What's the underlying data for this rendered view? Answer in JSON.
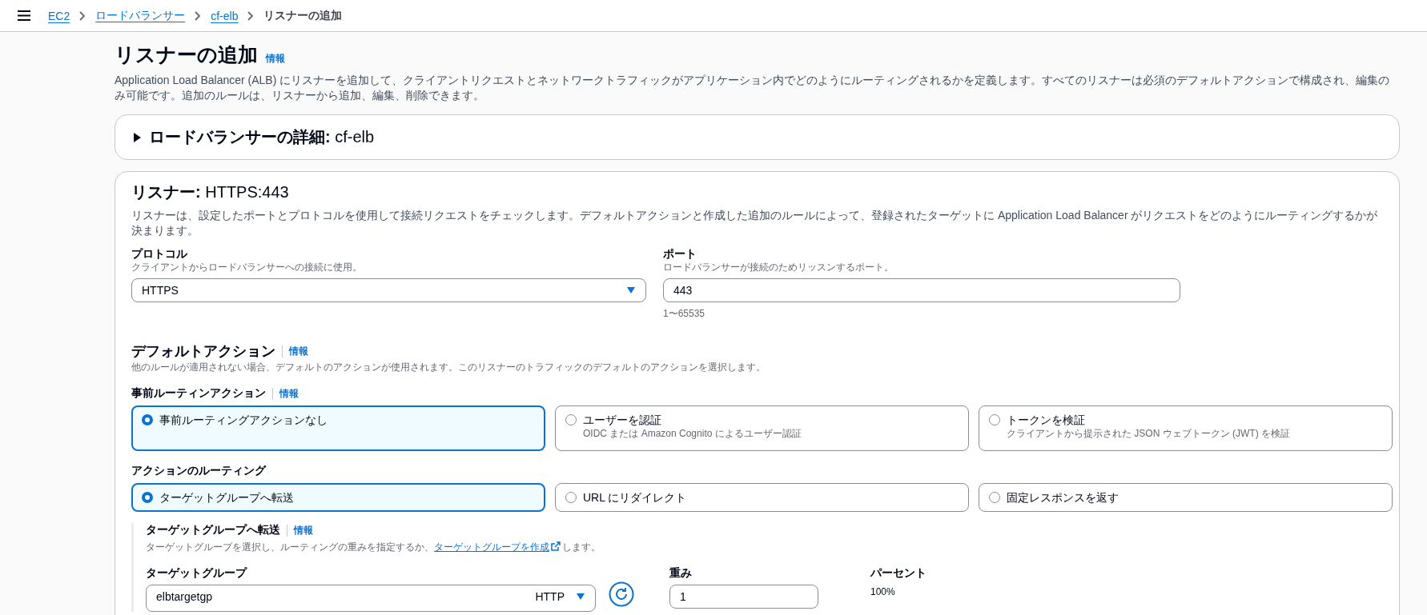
{
  "breadcrumbs": [
    {
      "label": "EC2",
      "kind": "link"
    },
    {
      "label": "ロードバランサー",
      "kind": "link"
    },
    {
      "label": "cf-elb",
      "kind": "link"
    },
    {
      "label": "リスナーの追加",
      "kind": "current"
    }
  ],
  "page": {
    "title": "リスナーの追加",
    "info_link": "情報",
    "description": "Application Load Balancer (ALB) にリスナーを追加して、クライアントリクエストとネットワークトラフィックがアプリケーション内でどのようにルーティングされるかを定義します。すべてのリスナーは必須のデフォルトアクションで構成され、編集のみ可能です。追加のルールは、リスナーから追加、編集、削除できます。"
  },
  "lb_details": {
    "label": "ロードバランサーの詳細:",
    "value": "cf-elb",
    "expanded": false
  },
  "listener": {
    "title_label": "リスナー:",
    "title_value": "HTTPS:443",
    "description": "リスナーは、設定したポートとプロトコルを使用して接続リクエストをチェックします。デフォルトアクションと作成した追加のルールによって、登録されたターゲットに Application Load Balancer がリクエストをどのようにルーティングするかが決まります。"
  },
  "protocol": {
    "label": "プロトコル",
    "description": "クライアントからロードバランサーへの接続に使用。",
    "value": "HTTPS"
  },
  "port": {
    "label": "ポート",
    "description": "ロードバランサーが接続のためリッスンするポート。",
    "value": "443",
    "constraint": "1〜65535"
  },
  "default_action": {
    "title": "デフォルトアクション",
    "info_link": "情報",
    "description": "他のルールが適用されない場合、デフォルトのアクションが使用されます。このリスナーのトラフィックのデフォルトのアクションを選択します。"
  },
  "pre_routing": {
    "label": "事前ルーティンアクション",
    "info_link": "情報",
    "options": [
      {
        "label": "事前ルーティングアクションなし",
        "selected": true
      },
      {
        "label": "ユーザーを認証",
        "description": "OIDC または Amazon Cognito によるユーザー認証",
        "selected": false
      },
      {
        "label": "トークンを検証",
        "description": "クライアントから提示された JSON ウェブトークン (JWT) を検証",
        "selected": false
      }
    ]
  },
  "routing": {
    "label": "アクションのルーティング",
    "options": [
      {
        "label": "ターゲットグループへ転送",
        "selected": true
      },
      {
        "label": "URL にリダイレクト",
        "selected": false
      },
      {
        "label": "固定レスポンスを返す",
        "selected": false
      }
    ]
  },
  "forward": {
    "title": "ターゲットグループへ転送",
    "info_link": "情報",
    "description_before": "ターゲットグループを選択し、ルーティングの重みを指定するか、",
    "link": "ターゲットグループを作成",
    "description_after": "します。",
    "target_group": {
      "label": "ターゲットグループ",
      "value": "elbtargetgp",
      "protocol": "HTTP"
    },
    "weight": {
      "label": "重み",
      "value": "1"
    },
    "percent": {
      "label": "パーセント",
      "value": "100%"
    }
  }
}
